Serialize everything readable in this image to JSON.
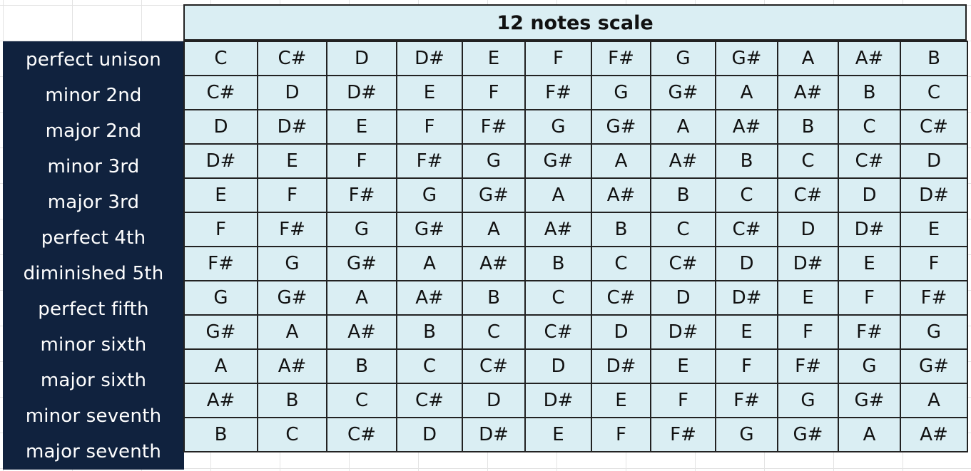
{
  "title": "12 notes scale",
  "intervals": [
    {
      "label": "perfect unison",
      "notes": [
        "C",
        "C#",
        "D",
        "D#",
        "E",
        "F",
        "F#",
        "G",
        "G#",
        "A",
        "A#",
        "B"
      ]
    },
    {
      "label": "minor 2nd",
      "notes": [
        "C#",
        "D",
        "D#",
        "E",
        "F",
        "F#",
        "G",
        "G#",
        "A",
        "A#",
        "B",
        "C"
      ]
    },
    {
      "label": "major 2nd",
      "notes": [
        "D",
        "D#",
        "E",
        "F",
        "F#",
        "G",
        "G#",
        "A",
        "A#",
        "B",
        "C",
        "C#"
      ]
    },
    {
      "label": "minor 3rd",
      "notes": [
        "D#",
        "E",
        "F",
        "F#",
        "G",
        "G#",
        "A",
        "A#",
        "B",
        "C",
        "C#",
        "D"
      ]
    },
    {
      "label": "major 3rd",
      "notes": [
        "E",
        "F",
        "F#",
        "G",
        "G#",
        "A",
        "A#",
        "B",
        "C",
        "C#",
        "D",
        "D#"
      ]
    },
    {
      "label": "perfect 4th",
      "notes": [
        "F",
        "F#",
        "G",
        "G#",
        "A",
        "A#",
        "B",
        "C",
        "C#",
        "D",
        "D#",
        "E"
      ]
    },
    {
      "label": "diminished 5th",
      "notes": [
        "F#",
        "G",
        "G#",
        "A",
        "A#",
        "B",
        "C",
        "C#",
        "D",
        "D#",
        "E",
        "F"
      ]
    },
    {
      "label": "perfect fifth",
      "notes": [
        "G",
        "G#",
        "A",
        "A#",
        "B",
        "C",
        "C#",
        "D",
        "D#",
        "E",
        "F",
        "F#"
      ]
    },
    {
      "label": "minor sixth",
      "notes": [
        "G#",
        "A",
        "A#",
        "B",
        "C",
        "C#",
        "D",
        "D#",
        "E",
        "F",
        "F#",
        "G"
      ]
    },
    {
      "label": "major sixth",
      "notes": [
        "A",
        "A#",
        "B",
        "C",
        "C#",
        "D",
        "D#",
        "E",
        "F",
        "F#",
        "G",
        "G#"
      ]
    },
    {
      "label": "minor seventh",
      "notes": [
        "A#",
        "B",
        "C",
        "C#",
        "D",
        "D#",
        "E",
        "F",
        "F#",
        "G",
        "G#",
        "A"
      ]
    },
    {
      "label": "major seventh",
      "notes": [
        "B",
        "C",
        "C#",
        "D",
        "D#",
        "E",
        "F",
        "F#",
        "G",
        "G#",
        "A",
        "A#"
      ]
    }
  ],
  "colors": {
    "label_background": "#10223e",
    "cell_background": "#daeef3",
    "border": "#222222"
  }
}
